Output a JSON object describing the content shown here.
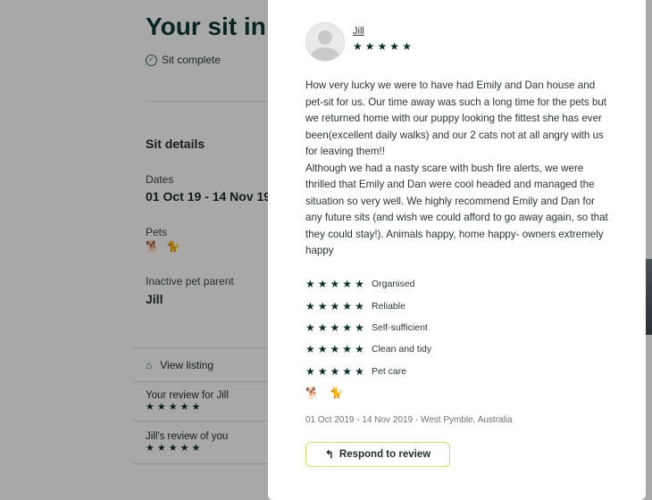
{
  "background": {
    "title": "Your sit in",
    "status": "Sit complete",
    "section_title": "Sit details",
    "dates_label": "Dates",
    "dates_value": "01 Oct 19 - 14 Nov 19",
    "pets_label": "Pets",
    "pets": [
      "dog-icon",
      "cat-icon"
    ],
    "parent_label": "Inactive pet parent",
    "parent_value": "Jill",
    "view_listing": "View listing",
    "your_review_label": "Your review for Jill",
    "their_review_label": "Jill's review of you",
    "your_review_rating": 5,
    "their_review_rating": 5
  },
  "modal": {
    "reviewer_name": "Jill",
    "rating": 5,
    "review_paragraphs": [
      "How very lucky we were to have had Emily and Dan house and pet-sit for us. Our time away was such a long time for the pets but we returned home with our puppy looking the fittest she has ever been(excellent daily walks) and our 2 cats not at all angry with us for leaving them!!",
      "Although we had a nasty scare with bush fire alerts, we were thrilled that Emily and Dan were cool headed and managed the situation so very well. We highly recommend Emily and Dan for any future sits (and wish we could afford to go away again, so that they could stay!). Animals happy, home happy- owners extremely happy"
    ],
    "criteria": [
      {
        "label": "Organised",
        "rating": 5
      },
      {
        "label": "Reliable",
        "rating": 5
      },
      {
        "label": "Self-sufficient",
        "rating": 5
      },
      {
        "label": "Clean and tidy",
        "rating": 5
      },
      {
        "label": "Pet care",
        "rating": 5
      }
    ],
    "pets": [
      "dog-icon",
      "cat-icon"
    ],
    "meta": "01 Oct 2019 - 14 Nov 2019 · West Pymble, Australia",
    "respond_label": "Respond to review"
  },
  "colors": {
    "brand_dark": "#0b3b36",
    "button_border": "#c8e06a",
    "star": "#0b2f2b"
  }
}
